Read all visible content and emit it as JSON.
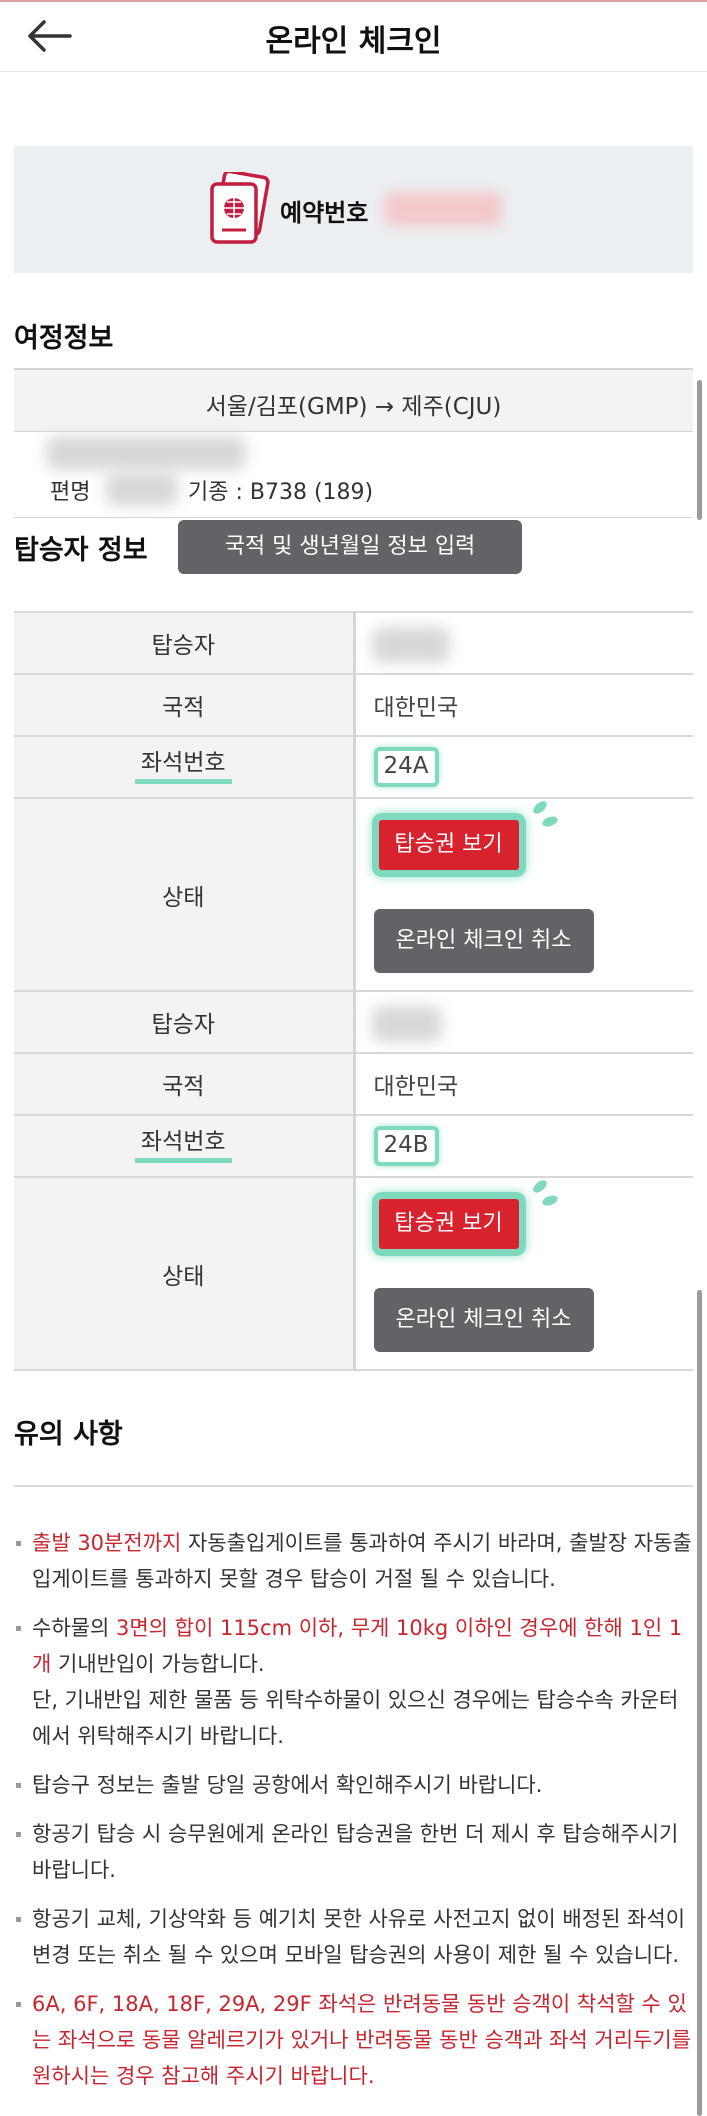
{
  "header": {
    "title": "온라인 체크인",
    "back_icon": "arrow-left-icon"
  },
  "booking": {
    "label": "예약번호",
    "icon": "passport-icon"
  },
  "itinerary": {
    "title": "여정정보",
    "route": "서울/김포(GMP) → 제주(CJU)",
    "flight_label": "편명",
    "aircraft": "기종 : B738 (189)"
  },
  "passenger_section": {
    "title": "탑승자 정보",
    "input_button": "국적 및 생년월일 정보 입력"
  },
  "labels": {
    "passenger": "탑승자",
    "nationality": "국적",
    "seat": "좌석번호",
    "status": "상태"
  },
  "passengers": [
    {
      "nationality": "대한민국",
      "seat": "24A",
      "boarding_pass_button": "탑승권 보기",
      "cancel_button": "온라인 체크인 취소"
    },
    {
      "nationality": "대한민국",
      "seat": "24B",
      "boarding_pass_button": "탑승권 보기",
      "cancel_button": "온라인 체크인 취소"
    }
  ],
  "notice": {
    "title": "유의 사항",
    "n1_red": "출발 30분전까지",
    "n1_rest": " 자동출입게이트를 통과하여 주시기 바라며, 출발장 자동출입게이트를 통과하지 못할 경우 탑승이 거절 될 수 있습니다.",
    "n2_pre": "수하물의 ",
    "n2_red": "3면의 합이 115cm 이하, 무게 10kg 이하인 경우에 한해 1인 1개",
    "n2_post": " 기내반입이 가능합니다.",
    "n2_line2": "단, 기내반입 제한 물품 등 위탁수하물이 있으신 경우에는 탑승수속 카운터에서 위탁해주시기 바랍니다.",
    "n3": "탑승구 정보는 출발 당일 공항에서 확인해주시기 바랍니다.",
    "n4": "항공기 탑승 시 승무원에게 온라인 탑승권을 한번 더 제시 후 탑승해주시기 바랍니다.",
    "n5": "항공기 교체, 기상악화 등 예기치 못한 사유로 사전고지 없이 배정된 좌석이 변경 또는 취소 될 수 있으며 모바일 탑승권의 사용이 제한 될 수 있습니다.",
    "n6_red": "6A, 6F, 18A, 18F, 29A, 29F 좌석은 반려동물 동반 승객이 착석할 수 있는 좌석으로 동물 알레르기가 있거나 반려동물 동반 승객과 좌석 거리두기를 원하시는 경우 참고해 주시기 바랍니다."
  },
  "colors": {
    "accent_red": "#d8222d",
    "highlight_green": "#7ed9be",
    "button_grey": "#626366"
  }
}
